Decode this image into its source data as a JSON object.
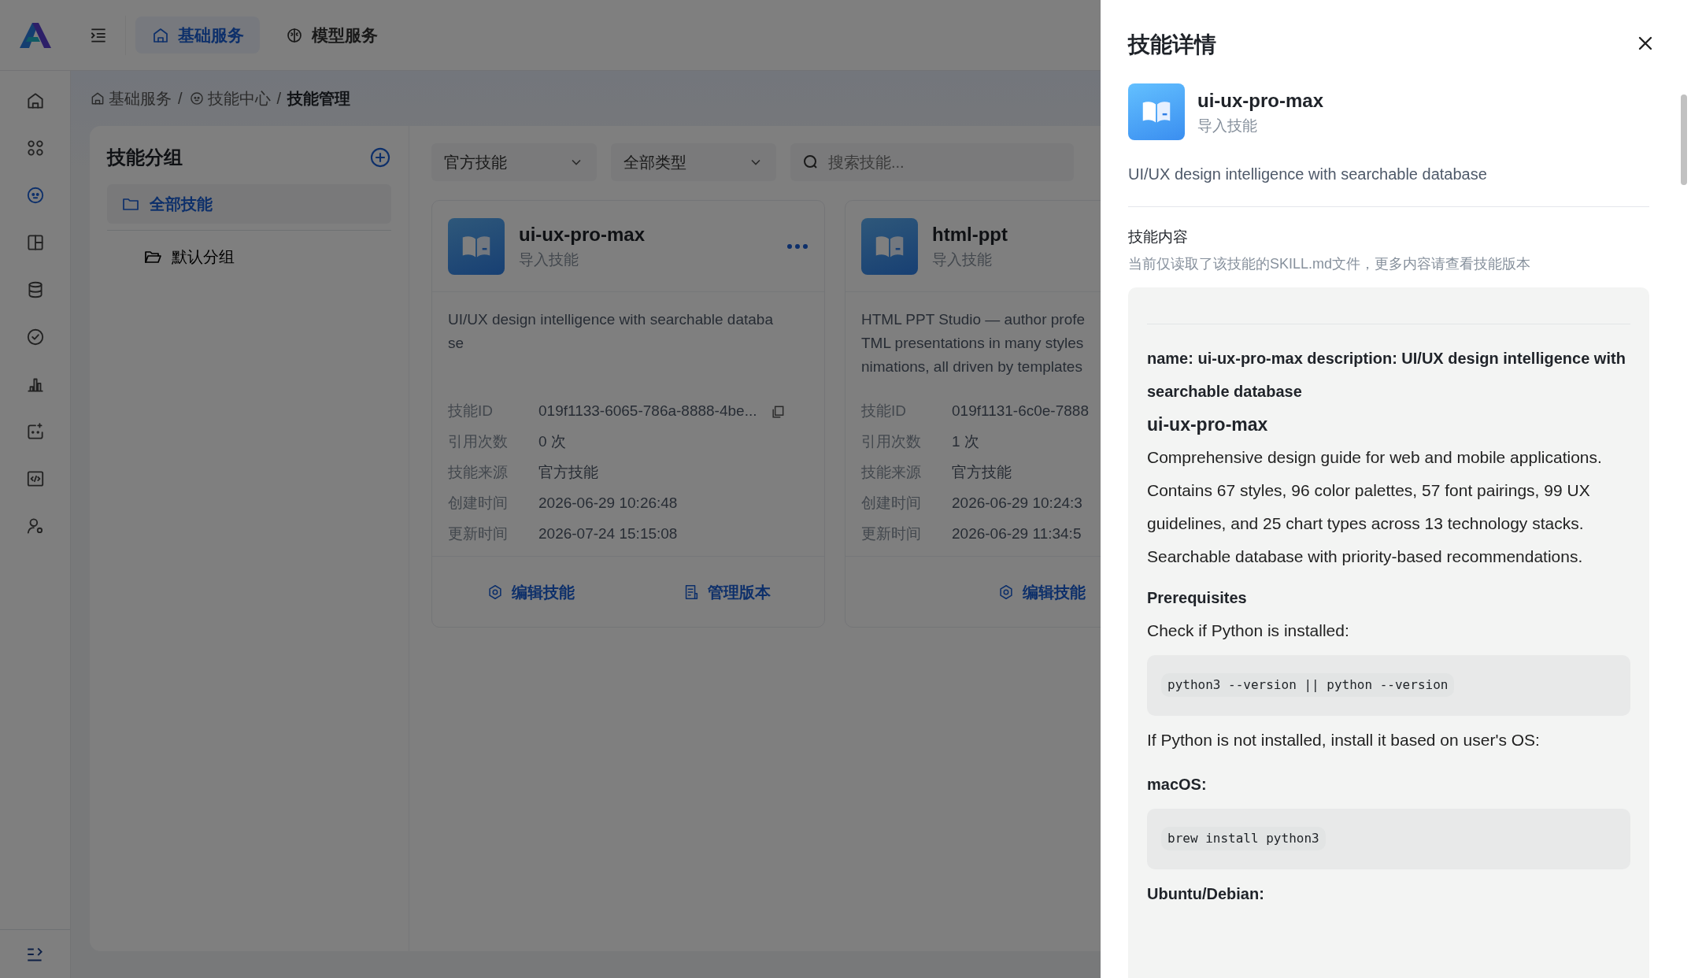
{
  "header": {
    "tabs": [
      {
        "label": "基础服务",
        "selected": true
      },
      {
        "label": "模型服务",
        "selected": false
      }
    ]
  },
  "sidebar": {
    "items": [
      {
        "selected": false
      },
      {
        "selected": false
      },
      {
        "selected": true
      },
      {
        "selected": false
      },
      {
        "selected": false
      },
      {
        "selected": false
      },
      {
        "selected": false
      },
      {
        "selected": false
      },
      {
        "selected": false
      },
      {
        "selected": false
      }
    ]
  },
  "breadcrumb": {
    "separator": "/",
    "items": [
      {
        "text": "基础服务",
        "current": false
      },
      {
        "text": "技能中心",
        "current": false
      },
      {
        "text": "技能管理",
        "current": true
      }
    ]
  },
  "groups": {
    "title": "技能分组",
    "items": [
      {
        "label": "全部技能",
        "selected": true,
        "children": [
          {
            "label": "默认分组",
            "selected": false
          }
        ]
      }
    ]
  },
  "filters": {
    "selects": [
      {
        "value": "官方技能"
      },
      {
        "value": "全部类型"
      }
    ],
    "search": {
      "placeholder": "搜索技能..."
    }
  },
  "cards": [
    {
      "title": "ui-ux-pro-max",
      "subtitle": "导入技能",
      "more": true,
      "description_lines": [
        "UI/UX design intelligence with searchable databa",
        "se"
      ],
      "fields": [
        {
          "label": "技能ID",
          "value": "019f1133-6065-786a-8888-4be...",
          "copyable": true
        },
        {
          "label": "引用次数",
          "value": "0 次"
        },
        {
          "label": "技能来源",
          "value": "官方技能"
        },
        {
          "label": "创建时间",
          "value": "2026-06-29 10:26:48"
        },
        {
          "label": "更新时间",
          "value": "2026-07-24 15:15:08"
        }
      ],
      "actions": [
        {
          "label": "编辑技能"
        },
        {
          "label": "管理版本"
        }
      ]
    },
    {
      "title": "html-ppt",
      "subtitle": "导入技能",
      "more": false,
      "description_lines": [
        "HTML PPT Studio — author profe",
        "TML presentations in many styles",
        "nimations, all driven by templates"
      ],
      "fields": [
        {
          "label": "技能ID",
          "value": "019f1131-6c0e-7888"
        },
        {
          "label": "引用次数",
          "value": "1 次"
        },
        {
          "label": "技能来源",
          "value": "官方技能"
        },
        {
          "label": "创建时间",
          "value": "2026-06-29 10:24:3"
        },
        {
          "label": "更新时间",
          "value": "2026-06-29 11:34:5"
        }
      ],
      "actions": [
        {
          "label": "编辑技能"
        }
      ]
    }
  ],
  "drawer": {
    "title": "技能详情",
    "name": "ui-ux-pro-max",
    "subtitle": "导入技能",
    "description": "UI/UX design intelligence with searchable database",
    "section_title": "技能内容",
    "section_note": "当前仅读取了该技能的SKILL.md文件，更多内容请查看技能版本",
    "content": [
      {
        "kind": "meta",
        "text": "name: ui-ux-pro-max description: UI/UX design intelligence with searchable database"
      },
      {
        "kind": "h1",
        "text": "ui-ux-pro-max"
      },
      {
        "kind": "p",
        "text": "Comprehensive design guide for web and mobile applications. Contains 67 styles, 96 color palettes, 57 font pairings, 99 UX guidelines, and 25 chart types across 13 technology stacks. Searchable database with priority-based recommendations."
      },
      {
        "kind": "h2",
        "text": "Prerequisites"
      },
      {
        "kind": "p",
        "text": "Check if Python is installed:"
      },
      {
        "kind": "code",
        "text": "python3 --version || python --version"
      },
      {
        "kind": "p",
        "text": "If Python is not installed, install it based on user's OS:"
      },
      {
        "kind": "h3",
        "text": "macOS:"
      },
      {
        "kind": "code",
        "text": "brew install python3"
      },
      {
        "kind": "h3",
        "text": "Ubuntu/Debian:"
      }
    ]
  }
}
